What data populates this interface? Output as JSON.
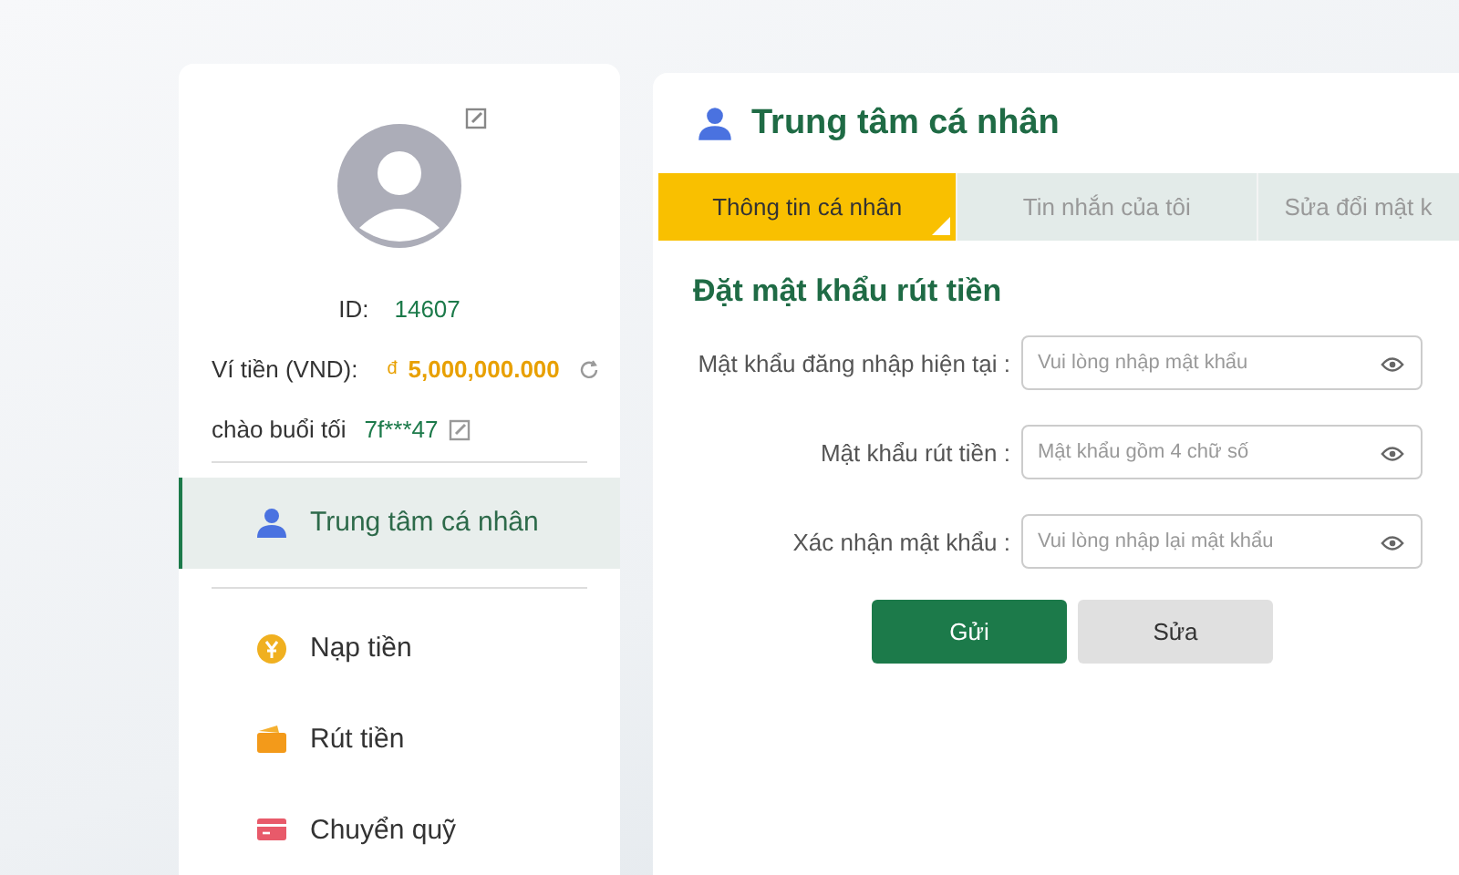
{
  "profile": {
    "id_label": "ID:",
    "id_value": "14607",
    "wallet_label": "Ví tiền (VND):",
    "currency": "đ",
    "balance": "5,000,000.000",
    "greeting": "chào buổi tối",
    "username": "7f***47"
  },
  "menu": [
    {
      "kind": "person",
      "label": "Trung tâm cá nhân",
      "selected": true
    },
    {
      "kind": "coin",
      "label": "Nạp tiền",
      "selected": false
    },
    {
      "kind": "wallet",
      "label": "Rút tiền",
      "selected": false
    },
    {
      "kind": "card",
      "label": "Chuyển quỹ",
      "selected": false
    }
  ],
  "panel": {
    "title": "Trung tâm cá nhân"
  },
  "tabs": [
    {
      "label": "Thông tin cá nhân",
      "selected": true
    },
    {
      "label": "Tin nhắn của tôi",
      "selected": false
    },
    {
      "label": "Sửa đổi mật k",
      "selected": false
    }
  ],
  "form": {
    "title": "Đặt mật khẩu rút tiền",
    "fields": [
      {
        "label": "Mật khẩu đăng nhập hiện tại :",
        "placeholder": "Vui lòng nhập mật khẩu"
      },
      {
        "label": "Mật khẩu rút tiền :",
        "placeholder": "Mật khẩu gồm 4 chữ số"
      },
      {
        "label": "Xác nhận mật khẩu :",
        "placeholder": "Vui lòng nhập lại mật khẩu"
      }
    ],
    "buttons": [
      {
        "kind": "primary",
        "label": "Gửi"
      },
      {
        "kind": "secondary",
        "label": "Sửa"
      }
    ]
  }
}
